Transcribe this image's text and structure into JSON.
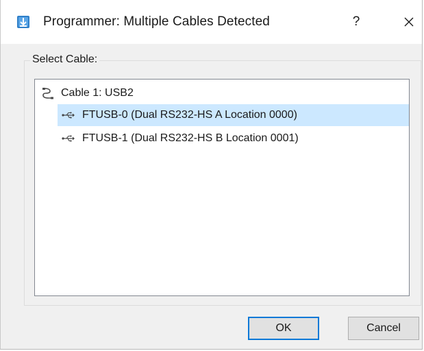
{
  "window": {
    "title": "Programmer: Multiple Cables Detected",
    "help_label": "?",
    "close_icon": "close-icon"
  },
  "group": {
    "label": "Select Cable:"
  },
  "tree": {
    "root": {
      "label": "Cable 1: USB2",
      "icon": "cable-icon"
    },
    "children": [
      {
        "label": "FTUSB-0 (Dual RS232-HS A Location 0000)",
        "icon": "usb-icon",
        "selected": true
      },
      {
        "label": "FTUSB-1 (Dual RS232-HS B Location 0001)",
        "icon": "usb-icon",
        "selected": false
      }
    ]
  },
  "buttons": {
    "ok_label": "OK",
    "cancel_label": "Cancel"
  },
  "colors": {
    "selection": "#cce8ff",
    "accent": "#0078d7"
  }
}
